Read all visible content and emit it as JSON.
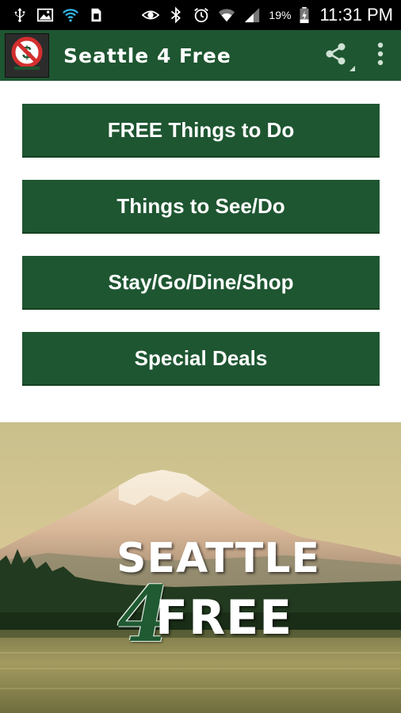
{
  "status_bar": {
    "battery_percent": "19%",
    "time": "11:31 PM",
    "left_icons": [
      "usb-icon",
      "image-icon",
      "wifi-sync-icon",
      "sim-icon"
    ],
    "right_icons": [
      "eye-icon",
      "bluetooth-icon",
      "alarm-icon",
      "wifi-icon",
      "signal-icon",
      "battery-charging-icon"
    ]
  },
  "app_bar": {
    "title": "Seattle 4 Free",
    "logo_icon": "no-dollar-logo-icon",
    "share_icon": "share-icon",
    "overflow_icon": "overflow-menu-icon"
  },
  "menu": {
    "items": [
      {
        "label": "FREE Things to Do"
      },
      {
        "label": "Things to See/Do"
      },
      {
        "label": "Stay/Go/Dine/Shop"
      },
      {
        "label": "Special Deals"
      }
    ]
  },
  "banner": {
    "line1": "SEATTLE",
    "four": "4",
    "line2": "FREE"
  },
  "colors": {
    "brand_green": "#1e5631",
    "status_bar": "#000000",
    "background": "#ffffff"
  }
}
